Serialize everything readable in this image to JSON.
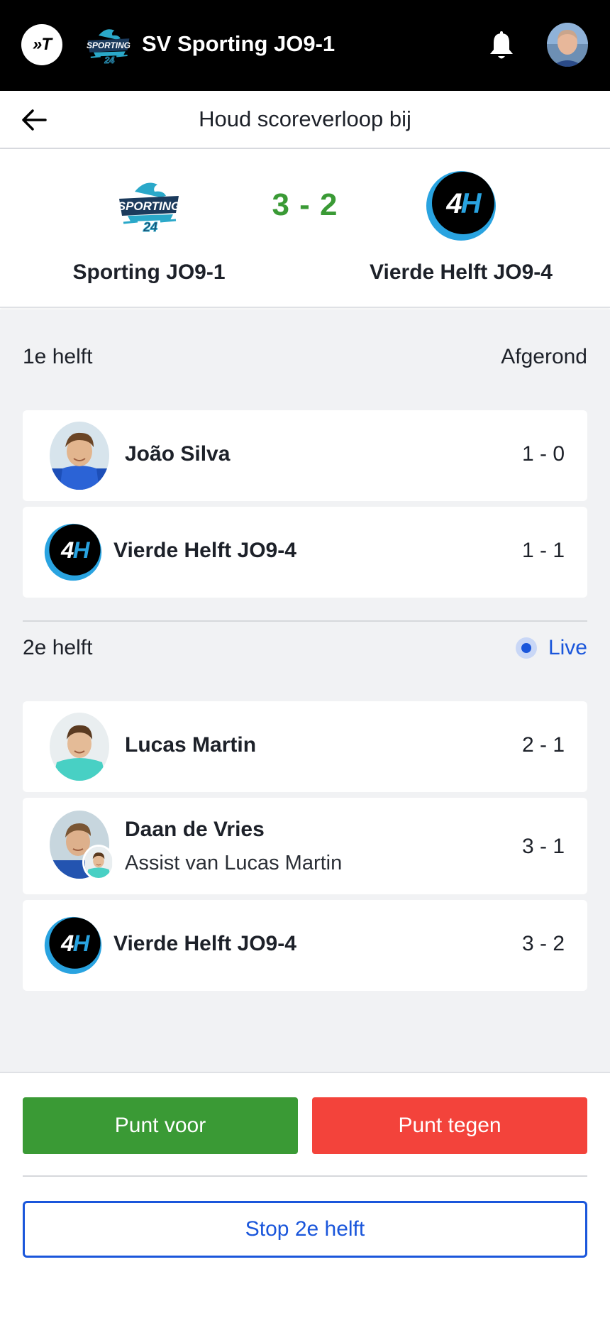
{
  "topbar": {
    "club_title": "SV Sporting JO9-1",
    "app_logo_text": "»T",
    "icons": [
      "app-logo",
      "club-logo",
      "bell-icon",
      "user-avatar"
    ]
  },
  "subheader": {
    "title": "Houd scoreverloop bij",
    "back_icon": "arrow-left-icon"
  },
  "match": {
    "home_team": "Sporting JO9-1",
    "away_team": "Vierde Helft JO9-4",
    "score": "3 - 2",
    "away_logo_text": "4H"
  },
  "halves": [
    {
      "label": "1e helft",
      "status": "Afgerond",
      "events": [
        {
          "name": "João Silva",
          "score": "1 - 0"
        },
        {
          "name": "Vierde Helft JO9-4",
          "score": "1 - 1"
        }
      ]
    },
    {
      "label": "2e helft",
      "status": "Live",
      "events": [
        {
          "name": "Lucas Martin",
          "score": "2 - 1"
        },
        {
          "name": "Daan de Vries",
          "assist": "Assist van Lucas Martin",
          "score": "3 - 1"
        },
        {
          "name": "Vierde Helft JO9-4",
          "score": "3 - 2"
        }
      ]
    }
  ],
  "actions": {
    "point_for": "Punt voor",
    "point_against": "Punt tegen",
    "stop_half": "Stop 2e helft"
  },
  "colors": {
    "score_green": "#3a9a35",
    "against_red": "#f3433b",
    "live_blue": "#1a56db"
  }
}
